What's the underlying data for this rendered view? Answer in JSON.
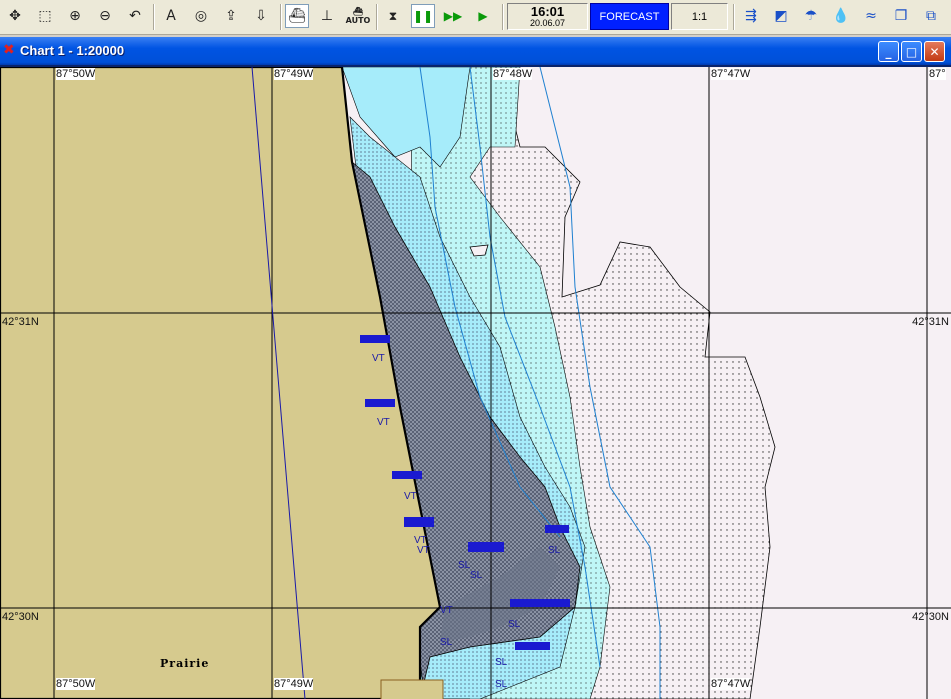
{
  "toolbar": {
    "buttons_left": [
      {
        "name": "pan-tool-icon",
        "glyph": "✥"
      },
      {
        "name": "zoom-window-icon",
        "glyph": "⬚"
      },
      {
        "name": "zoom-in-icon",
        "glyph": "⊕"
      },
      {
        "name": "zoom-out-icon",
        "glyph": "⊖"
      },
      {
        "name": "undo-view-icon",
        "glyph": "↶"
      },
      {
        "name": "north-up-icon",
        "glyph": "A"
      },
      {
        "name": "center-target-icon",
        "glyph": "◎"
      },
      {
        "name": "export-icon",
        "glyph": "⇪"
      },
      {
        "name": "import-icon",
        "glyph": "⇩"
      },
      {
        "name": "ship-view-icon",
        "glyph": "⛴"
      },
      {
        "name": "ship-course-icon",
        "glyph": "⊥"
      }
    ],
    "auto_label": "AUTO",
    "playback": [
      {
        "name": "stop-icon",
        "glyph": "⧗"
      },
      {
        "name": "pause-icon",
        "glyph": "❚❚"
      },
      {
        "name": "fast-forward-icon",
        "glyph": "▶▶"
      },
      {
        "name": "play-icon",
        "glyph": "▶"
      }
    ],
    "clock": {
      "time": "16:01",
      "date": "20.06.07"
    },
    "forecast_label": "FORECAST",
    "scale_label": "1:1",
    "buttons_right": [
      {
        "name": "currents-icon",
        "glyph": "⇶"
      },
      {
        "name": "chart-graph-icon",
        "glyph": "◩"
      },
      {
        "name": "weather-icon",
        "glyph": "☂"
      },
      {
        "name": "precipitation-icon",
        "glyph": "💧"
      },
      {
        "name": "waves-icon",
        "glyph": "≈"
      },
      {
        "name": "copy-windows-icon",
        "glyph": "❐"
      },
      {
        "name": "cascade-windows-icon",
        "glyph": "⧉"
      }
    ]
  },
  "window": {
    "title": "Chart 1 - 1:20000",
    "minimize_glyph": "_",
    "maximize_glyph": "□",
    "close_glyph": "✕"
  },
  "chart": {
    "longitude_labels_top": [
      "87°50W",
      "87°49W",
      "87°48W",
      "87°47W",
      "87°"
    ],
    "longitude_labels_bottom": [
      "87°50W",
      "87°49W",
      "87°47W"
    ],
    "latitude_labels": [
      "42°31N",
      "42°31N",
      "42°30N",
      "42°30N"
    ],
    "place_name": "Prairie",
    "feature_labels": [
      "VT",
      "VT",
      "VT",
      "VT",
      "VT",
      "VT",
      "SL",
      "SL",
      "SL",
      "SL",
      "SL",
      "SL",
      "SL"
    ],
    "colors": {
      "land": "#d6ca8e",
      "grid_line": "#000000",
      "deep_water": "#f6f0f4",
      "shallow_water": "#bff6f6",
      "very_shallow": "#a6ecfa",
      "drying_area": "#6a7488",
      "symbols": "#1a1ad0"
    }
  }
}
